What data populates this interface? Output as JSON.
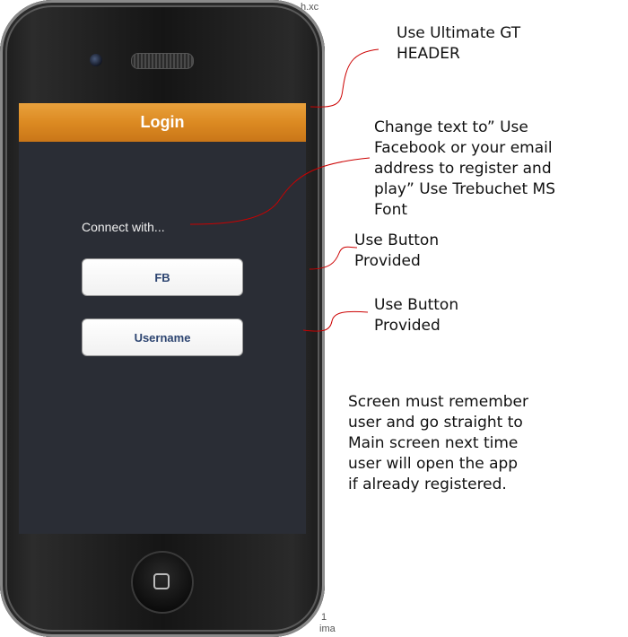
{
  "background": {
    "top_fragment": "h.xc",
    "bottom_fragments": [
      "1",
      "ima"
    ]
  },
  "screen": {
    "header_title": "Login",
    "connect_text": "Connect with...",
    "buttons": [
      {
        "label": "FB"
      },
      {
        "label": "Username"
      }
    ]
  },
  "annotations": [
    {
      "lines": [
        "Use Ultimate GT",
        "HEADER"
      ]
    },
    {
      "lines": [
        "Change text to” Use",
        "Facebook or your email",
        "address to register and",
        "play” Use Trebuchet MS",
        "Font"
      ]
    },
    {
      "lines": [
        "Use Button",
        "Provided"
      ]
    },
    {
      "lines": [
        "Use Button",
        "Provided"
      ]
    },
    {
      "lines": [
        "Screen must remember",
        "user and go straight to",
        "Main screen next time",
        "user will open the app",
        "if already registered."
      ]
    }
  ],
  "colors": {
    "header": "#dc8a22",
    "screen_bg": "#2a2d35",
    "button_text": "#2c4470",
    "connector": "#cc0000"
  },
  "icons": [
    "camera-icon",
    "speaker-grille-icon",
    "home-button-icon"
  ]
}
